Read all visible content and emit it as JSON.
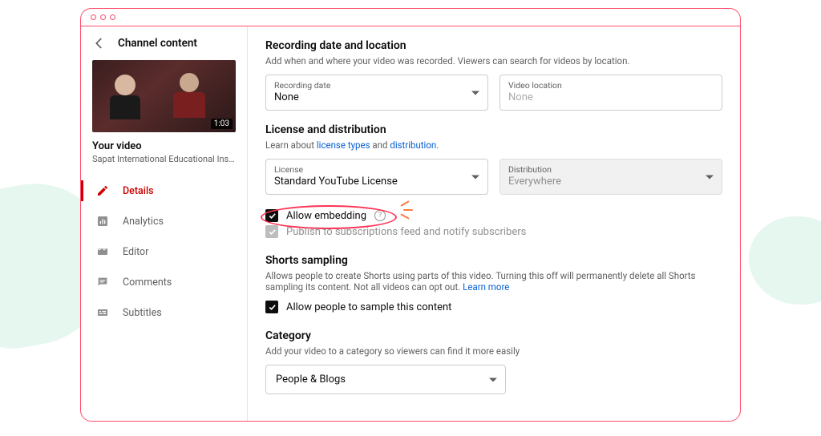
{
  "header": {
    "title": "Channel content"
  },
  "thumbnail": {
    "duration": "1:03"
  },
  "your_video": {
    "label": "Your video",
    "subtitle": "Sapat International Educational Insti..."
  },
  "nav": {
    "details": "Details",
    "analytics": "Analytics",
    "editor": "Editor",
    "comments": "Comments",
    "subtitles": "Subtitles"
  },
  "recording": {
    "heading": "Recording date and location",
    "desc": "Add when and where your video was recorded. Viewers can search for videos by location.",
    "date_label": "Recording date",
    "date_value": "None",
    "loc_label": "Video location",
    "loc_placeholder": "None"
  },
  "license": {
    "heading": "License and distribution",
    "desc_prefix": "Learn about ",
    "link1": "license types",
    "mid": " and ",
    "link2": "distribution",
    "license_label": "License",
    "license_value": "Standard YouTube License",
    "dist_label": "Distribution",
    "dist_value": "Everywhere",
    "allow_embed": "Allow embedding",
    "publish_feed": "Publish to subscriptions feed and notify subscribers"
  },
  "shorts": {
    "heading": "Shorts sampling",
    "desc": "Allows people to create Shorts using parts of this video. Turning this off will permanently delete all Shorts sampling its content. Not all videos can opt out. ",
    "learn": "Learn more",
    "allow_sample": "Allow people to sample this content"
  },
  "category": {
    "heading": "Category",
    "desc": "Add your video to a category so viewers can find it more easily",
    "value": "People & Blogs"
  }
}
